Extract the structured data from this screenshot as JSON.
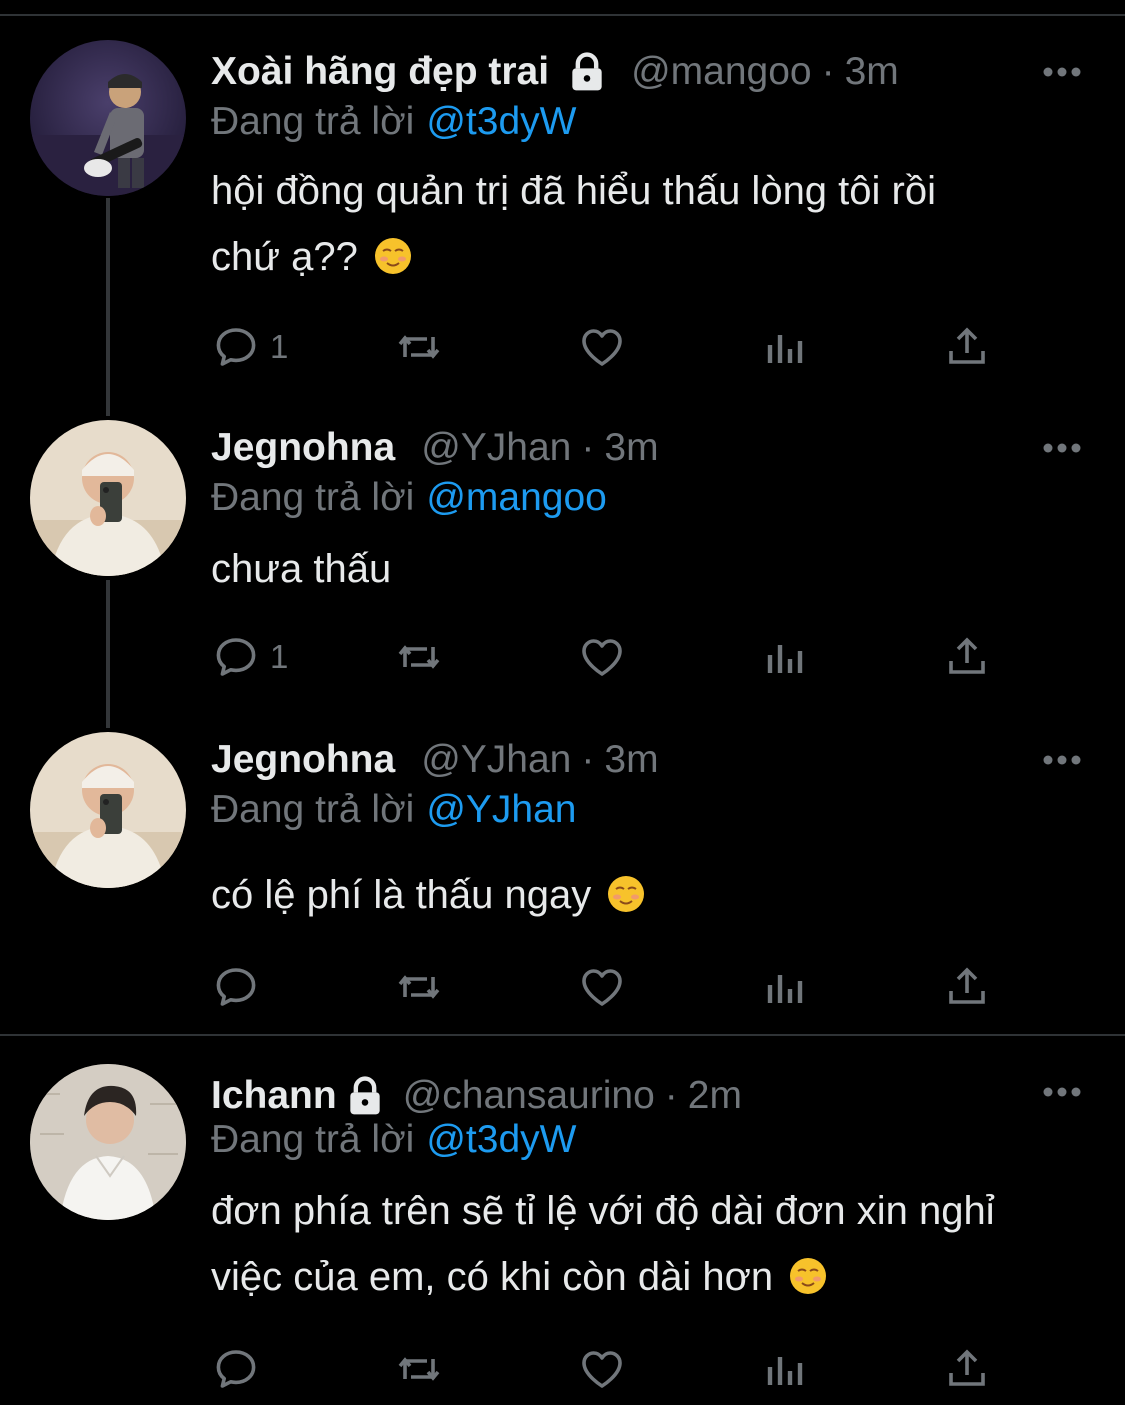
{
  "app": {
    "accent": "#1d9bf0",
    "background": "#000000",
    "muted": "#71767b",
    "text": "#e7e9ea"
  },
  "tweets": [
    {
      "name": "Xoài hãng đẹp trai",
      "locked": true,
      "handle": "@mangoo",
      "separator": "·",
      "time": "3m",
      "replying_label": "Đang trả lời",
      "replying_to": "@t3dyW",
      "text_lines": [
        "hội đồng quản trị đã hiểu thấu lòng tôi rồi",
        "chứ ạ??"
      ],
      "has_emoji": true,
      "emoji": "smiling-face-icon",
      "reply_count": "1",
      "avatar": "guitar-player-avatar"
    },
    {
      "name": "Jegnohna",
      "locked": false,
      "handle": "@YJhan",
      "separator": "·",
      "time": "3m",
      "replying_label": "Đang trả lời",
      "replying_to": "@mangoo",
      "text_lines": [
        "chưa thấu"
      ],
      "has_emoji": false,
      "reply_count": "1",
      "avatar": "mirror-selfie-avatar"
    },
    {
      "name": "Jegnohna",
      "locked": false,
      "handle": "@YJhan",
      "separator": "·",
      "time": "3m",
      "replying_label": "Đang trả lời",
      "replying_to": "@YJhan",
      "text_lines": [
        "có lệ phí là thấu ngay"
      ],
      "has_emoji": true,
      "emoji": "smiling-face-icon",
      "reply_count": "",
      "avatar": "mirror-selfie-avatar"
    },
    {
      "name": "Ichann",
      "locked": true,
      "handle": "@chansaurino",
      "separator": "·",
      "time": "2m",
      "replying_label": "Đang trả lời",
      "replying_to": "@t3dyW",
      "text_lines": [
        "đơn phía trên sẽ tỉ lệ với độ dài đơn xin nghỉ",
        "việc của em, có khi còn dài hơn"
      ],
      "has_emoji": true,
      "emoji": "smiling-face-icon",
      "reply_count": "",
      "avatar": "white-shirt-avatar"
    }
  ]
}
